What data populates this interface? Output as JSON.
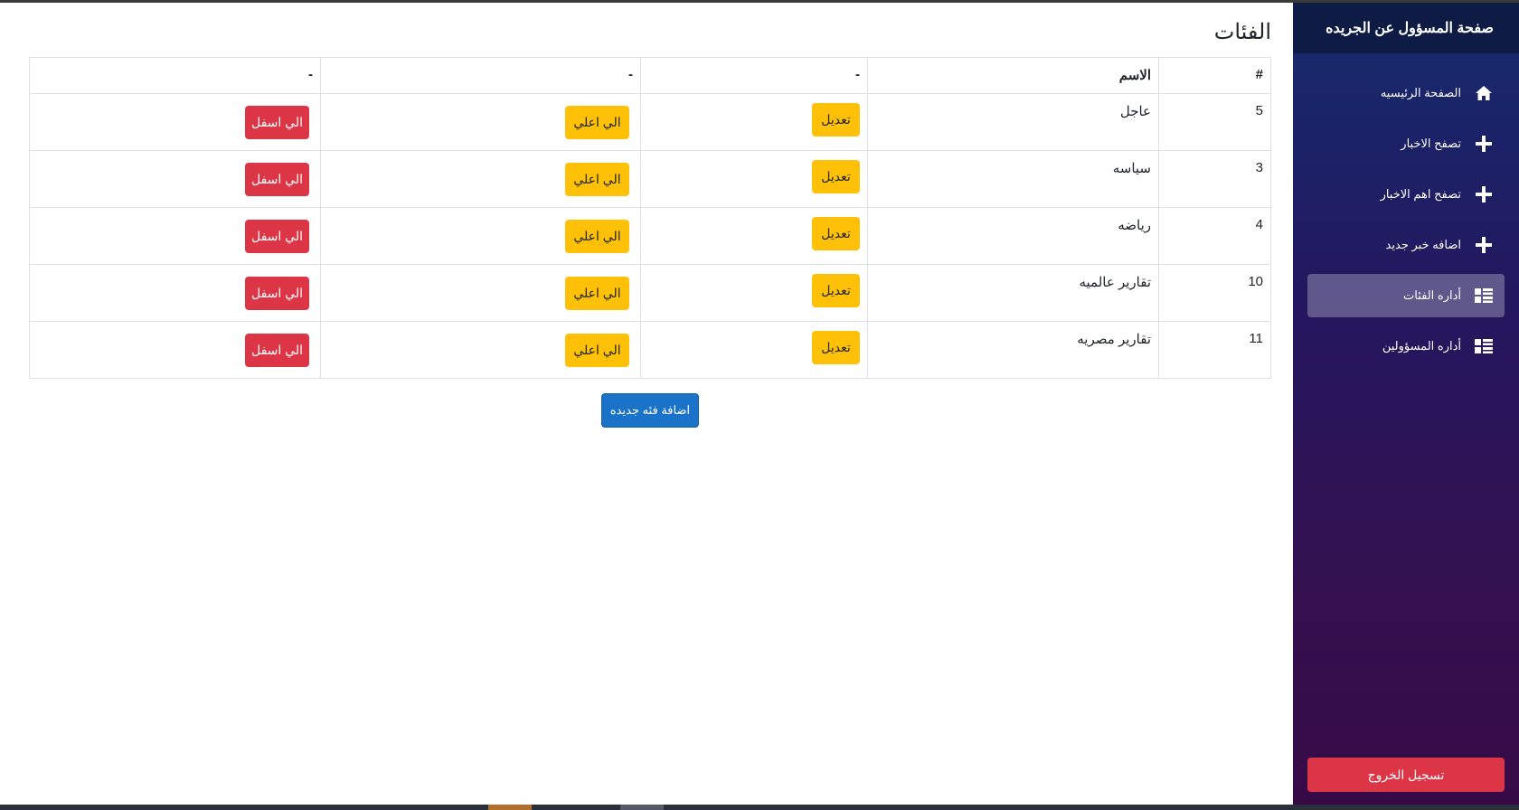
{
  "sidebar": {
    "title": "صفحة المسؤول عن الجريده",
    "items": [
      {
        "label": "الصفحة الرئيسيه",
        "icon": "home-icon",
        "active": false
      },
      {
        "label": "تصفح الاخبار",
        "icon": "plus-icon",
        "active": false
      },
      {
        "label": "تصفح اهم الاخبار",
        "icon": "plus-icon",
        "active": false
      },
      {
        "label": "اضافه خبر جديد",
        "icon": "plus-icon",
        "active": false
      },
      {
        "label": "أداره الفئات",
        "icon": "list-icon",
        "active": true
      },
      {
        "label": "أداره المسؤولين",
        "icon": "list-icon",
        "active": false
      }
    ],
    "logout_label": "تسجيل الخروج"
  },
  "main": {
    "title": "الفئات",
    "table": {
      "headers": [
        "#",
        "الاسم",
        "-",
        "-",
        "-"
      ],
      "rows": [
        {
          "id": "5",
          "name": "عاجل",
          "edit": "تعديل",
          "up": "الي اعلي",
          "down": "الي اسفل"
        },
        {
          "id": "3",
          "name": "سياسه",
          "edit": "تعديل",
          "up": "الي اعلي",
          "down": "الي اسفل"
        },
        {
          "id": "4",
          "name": "رياضه",
          "edit": "تعديل",
          "up": "الي اعلي",
          "down": "الي اسفل"
        },
        {
          "id": "10",
          "name": "تقارير عالميه",
          "edit": "تعديل",
          "up": "الي اعلي",
          "down": "الي اسفل"
        },
        {
          "id": "11",
          "name": "تقارير مصريه",
          "edit": "تعديل",
          "up": "الي اعلي",
          "down": "الي اسفل"
        }
      ]
    },
    "add_button": "اضافة فئه جديده"
  },
  "colors": {
    "sidebar_top": "#162b6e",
    "sidebar_bottom": "#360a46",
    "warning": "#ffc107",
    "danger": "#dc3545",
    "primary": "#1a73c8"
  }
}
